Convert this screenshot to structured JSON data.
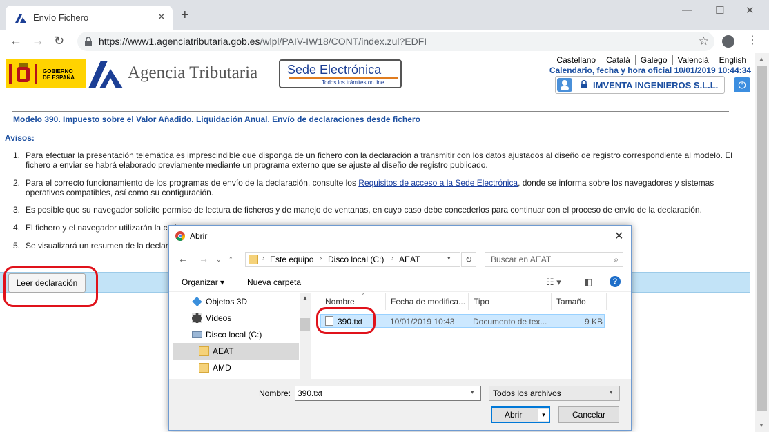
{
  "browser": {
    "tab_title": "Envío Fichero",
    "url_host": "https://www1.agenciatributaria.gob.es",
    "url_path": "/wlpl/PAIV-IW18/CONT/index.zul?EDFI"
  },
  "header": {
    "gov_line1": "GOBIERNO",
    "gov_line2": "DE ESPAÑA",
    "agency_name": "Agencia Tributaria",
    "sede_title": "Sede Electrónica",
    "sede_sub": "Todos los trámites on line",
    "languages": [
      "Castellano",
      "Català",
      "Galego",
      "Valencià",
      "English"
    ],
    "calendar": "Calendario, fecha y hora oficial 10/01/2019 10:44:34",
    "user_name": "IMVENTA INGENIEROS S.L.L."
  },
  "main": {
    "title": "Modelo 390. Impuesto sobre el Valor Añadido. Liquidación Anual. Envío de declaraciones desde fichero",
    "avisos_label": "Avisos:",
    "items": [
      {
        "num": "1.",
        "text": "Para efectuar la presentación telemática es imprescindible que disponga de un fichero con la declaración a transmitir con los datos ajustados al diseño de registro correspondiente al modelo. El fichero a enviar se habrá elaborado previamente mediante un programa externo que se ajuste al diseño de registro publicado."
      },
      {
        "num": "2.",
        "text_before": "Para el correcto funcionamiento de los programas de envío de la declaración, consulte los ",
        "link": "Requisitos de acceso a la Sede Electrónica",
        "text_after": ", donde se informa sobre los navegadores y sistemas operativos compatibles, así como su configuración."
      },
      {
        "num": "3.",
        "text": "Es posible que su navegador solicite permiso de lectura de ficheros y de manejo de ventanas, en cuyo caso debe concederlos para continuar con el proceso de envío de la declaración."
      },
      {
        "num": "4.",
        "text": "El fichero y el navegador utilizarán la cod"
      },
      {
        "num": "5.",
        "text": "Se visualizará un resumen de la declar"
      }
    ],
    "read_button": "Leer declaración"
  },
  "dialog": {
    "title": "Abrir",
    "breadcrumb": [
      "Este equipo",
      "Disco local (C:)",
      "AEAT"
    ],
    "search_placeholder": "Buscar en AEAT",
    "organize": "Organizar ▾",
    "new_folder": "Nueva carpeta",
    "nav_items": [
      {
        "label": "Objetos 3D",
        "icon": "cube-3d-icon"
      },
      {
        "label": "Vídeos",
        "icon": "video-icon"
      },
      {
        "label": "Disco local (C:)",
        "icon": "drive-icon"
      },
      {
        "label": "AEAT",
        "icon": "folder-icon",
        "selected": true
      },
      {
        "label": "AMD",
        "icon": "folder-icon"
      }
    ],
    "columns": [
      "Nombre",
      "Fecha de modifica...",
      "Tipo",
      "Tamaño"
    ],
    "files": [
      {
        "name": "390.txt",
        "date": "10/01/2019 10:43",
        "type": "Documento de tex...",
        "size": "9 KB"
      }
    ],
    "filename_label": "Nombre:",
    "filename_value": "390.txt",
    "filter_value": "Todos los archivos",
    "open_button": "Abrir",
    "cancel_button": "Cancelar"
  },
  "colors": {
    "accent_blue": "#1c4fa0",
    "highlight_red": "#e0121b",
    "bar_blue": "#c2e3f7"
  }
}
